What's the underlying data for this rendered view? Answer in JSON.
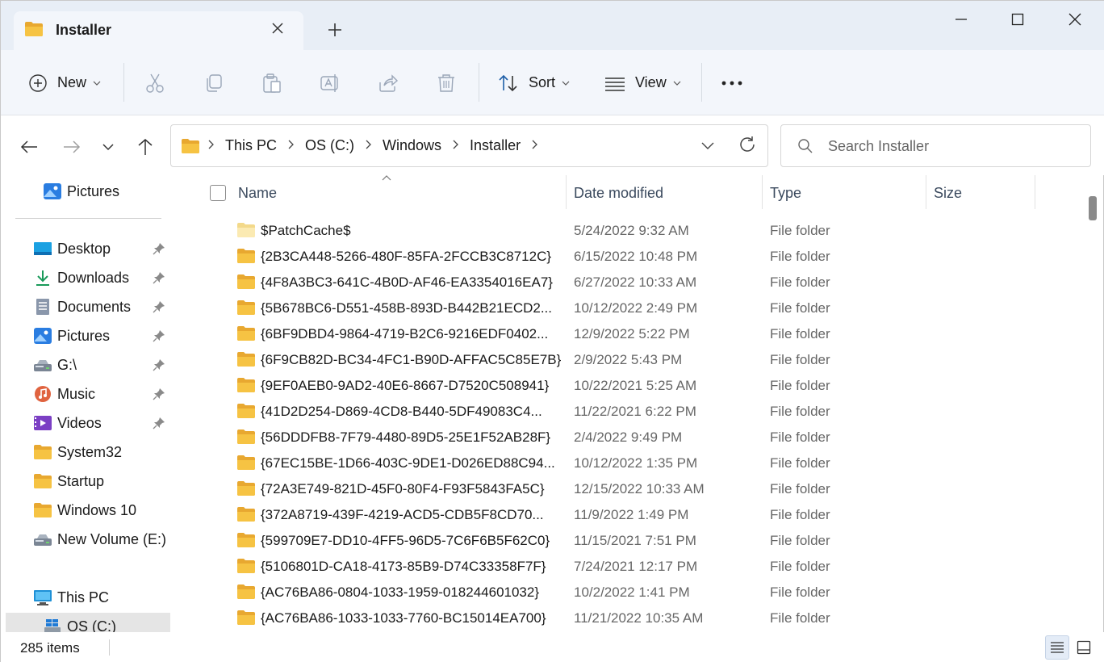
{
  "tab": {
    "title": "Installer",
    "close": "×"
  },
  "new_tab": "+",
  "toolbar": {
    "new_label": "New",
    "sort_label": "Sort",
    "view_label": "View",
    "more_label": "•••"
  },
  "address": {
    "crumbs": [
      "This PC",
      "OS (C:)",
      "Windows",
      "Installer"
    ]
  },
  "search": {
    "placeholder": "Search Installer"
  },
  "sidebar": {
    "top_item": "Pictures",
    "items": [
      {
        "label": "Desktop",
        "icon": "desktop-icon",
        "pinned": true
      },
      {
        "label": "Downloads",
        "icon": "download-icon",
        "pinned": true
      },
      {
        "label": "Documents",
        "icon": "documents-icon",
        "pinned": true
      },
      {
        "label": "Pictures",
        "icon": "pictures-icon",
        "pinned": true
      },
      {
        "label": "G:\\",
        "icon": "drive-icon",
        "pinned": true
      },
      {
        "label": "Music",
        "icon": "music-icon",
        "pinned": true
      },
      {
        "label": "Videos",
        "icon": "videos-icon",
        "pinned": true
      },
      {
        "label": "System32",
        "icon": "folder-icon",
        "pinned": false
      },
      {
        "label": "Startup",
        "icon": "folder-icon",
        "pinned": false
      },
      {
        "label": "Windows 10",
        "icon": "folder-icon",
        "pinned": false
      },
      {
        "label": "New Volume (E:)",
        "icon": "drive-icon",
        "pinned": false
      }
    ],
    "this_pc": "This PC",
    "os_drive": "OS (C:)"
  },
  "columns": {
    "name": "Name",
    "date": "Date modified",
    "type": "Type",
    "size": "Size"
  },
  "rows": [
    {
      "name": "$PatchCache$",
      "date": "5/24/2022 9:32 AM",
      "type": "File folder",
      "light": true
    },
    {
      "name": "{2B3CA448-5266-480F-85FA-2FCCB3C8712C}",
      "date": "6/15/2022 10:48 PM",
      "type": "File folder"
    },
    {
      "name": "{4F8A3BC3-641C-4B0D-AF46-EA3354016EA7}",
      "date": "6/27/2022 10:33 AM",
      "type": "File folder"
    },
    {
      "name": "{5B678BC6-D551-458B-893D-B442B21ECD2...",
      "date": "10/12/2022 2:49 PM",
      "type": "File folder"
    },
    {
      "name": "{6BF9DBD4-9864-4719-B2C6-9216EDF0402...",
      "date": "12/9/2022 5:22 PM",
      "type": "File folder"
    },
    {
      "name": "{6F9CB82D-BC34-4FC1-B90D-AFFAC5C85E7B}",
      "date": "2/9/2022 5:43 PM",
      "type": "File folder"
    },
    {
      "name": "{9EF0AEB0-9AD2-40E6-8667-D7520C508941}",
      "date": "10/22/2021 5:25 AM",
      "type": "File folder"
    },
    {
      "name": "{41D2D254-D869-4CD8-B440-5DF49083C4...",
      "date": "11/22/2021 6:22 PM",
      "type": "File folder"
    },
    {
      "name": "{56DDDFB8-7F79-4480-89D5-25E1F52AB28F}",
      "date": "2/4/2022 9:49 PM",
      "type": "File folder"
    },
    {
      "name": "{67EC15BE-1D66-403C-9DE1-D026ED88C94...",
      "date": "10/12/2022 1:35 PM",
      "type": "File folder"
    },
    {
      "name": "{72A3E749-821D-45F0-80F4-F93F5843FA5C}",
      "date": "12/15/2022 10:33 AM",
      "type": "File folder"
    },
    {
      "name": "{372A8719-439F-4219-ACD5-CDB5F8CD70...",
      "date": "11/9/2022 1:49 PM",
      "type": "File folder"
    },
    {
      "name": "{599709E7-DD10-4FF5-96D5-7C6F6B5F62C0}",
      "date": "11/15/2021 7:51 PM",
      "type": "File folder"
    },
    {
      "name": "{5106801D-CA18-4173-85B9-D74C33358F7F}",
      "date": "7/24/2021 12:17 PM",
      "type": "File folder"
    },
    {
      "name": "{AC76BA86-0804-1033-1959-018244601032}",
      "date": "10/2/2022 1:41 PM",
      "type": "File folder"
    },
    {
      "name": "{AC76BA86-1033-1033-7760-BC15014EA700}",
      "date": "11/21/2022 10:35 AM",
      "type": "File folder"
    }
  ],
  "status": {
    "count": "285 items"
  },
  "colors": {
    "folder": "#f6c343",
    "folder_dark": "#e8a830",
    "accent": "#0067c0",
    "titlebar": "#e8eef6"
  }
}
